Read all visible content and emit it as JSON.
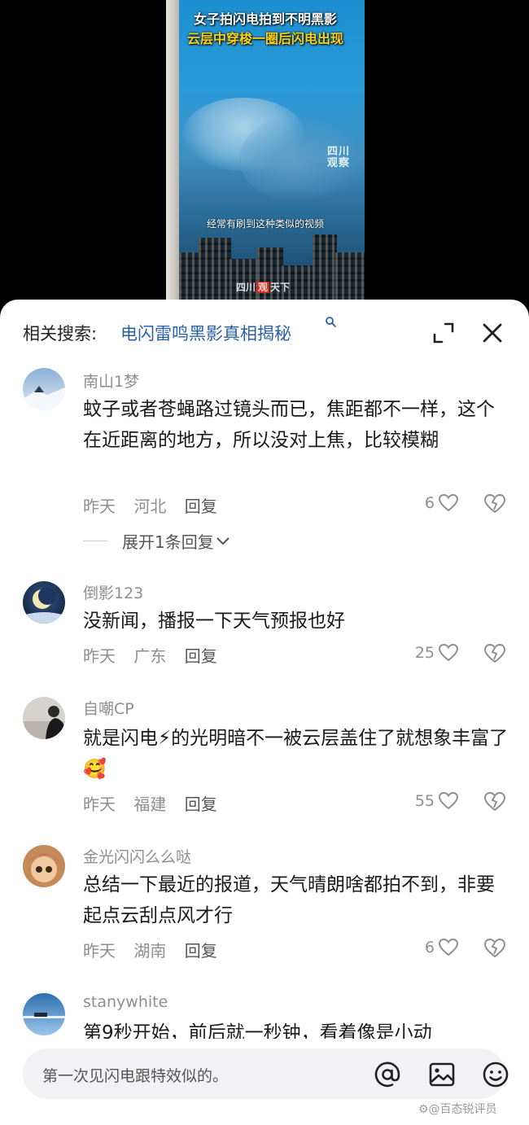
{
  "video": {
    "caption_line1": "女子拍闪电拍到不明黑影",
    "caption_line2": "云层中穿梭一圈后闪电出现",
    "subtitle": "经常有刷到这种类似的视频",
    "watermark_top": "四川 观察",
    "watermark_bottom_left": "四川",
    "watermark_bottom_mid": "观",
    "watermark_bottom_right": "天下"
  },
  "header": {
    "related_label": "相关搜索:",
    "related_query": "电闪雷鸣黑影真相揭秘"
  },
  "comments": [
    {
      "username": "南山1梦",
      "text": "蚊子或者苍蝇路过镜头而已，焦距都不一样，这个在近距离的地方，所以没对上焦，比较模糊",
      "time": "昨天",
      "location": "河北",
      "reply_label": "回复",
      "likes": "6",
      "expand_label": "展开1条回复"
    },
    {
      "username": "倒影123",
      "text": "没新闻，播报一下天气预报也好",
      "time": "昨天",
      "location": "广东",
      "reply_label": "回复",
      "likes": "25"
    },
    {
      "username": "自嘲CP",
      "text": "就是闪电⚡的光明暗不一被云层盖住了就想象丰富了🥰",
      "time": "昨天",
      "location": "福建",
      "reply_label": "回复",
      "likes": "55"
    },
    {
      "username": "金光闪闪么么哒",
      "text": "总结一下最近的报道，天气晴朗啥都拍不到，非要起点云刮点风才行",
      "time": "昨天",
      "location": "湖南",
      "reply_label": "回复",
      "likes": "6"
    },
    {
      "username": "stanywhite",
      "text": "第9秒开始，前后就一秒钟，看着像是小动"
    }
  ],
  "input": {
    "placeholder": "第一次见闪电跟特效似的。"
  },
  "watermark": "⚙@百态锐评员",
  "colors": {
    "link": "#2a5fa8",
    "muted": "#8e8e93"
  }
}
